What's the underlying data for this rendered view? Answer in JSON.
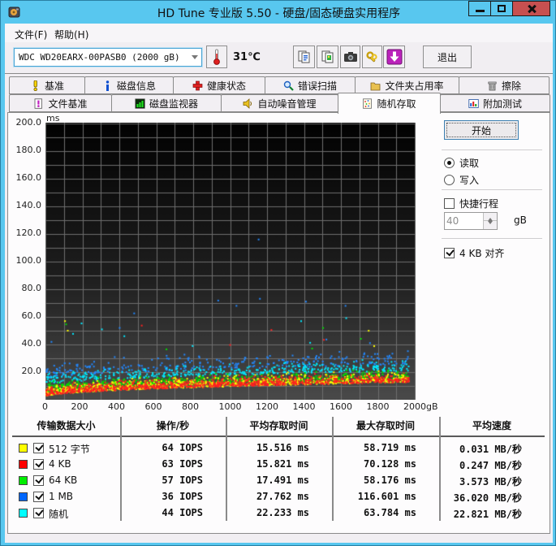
{
  "window": {
    "title": "HD Tune 专业版 5.50 - 硬盘/固态硬盘实用程序",
    "buttons": [
      "minimize",
      "maximize",
      "close"
    ]
  },
  "menu": {
    "file": "文件(F)",
    "help": "帮助(H)"
  },
  "toolbar": {
    "drive_selected": "WDC WD20EARX-00PASB0  (2000 gB)",
    "temperature": "31℃",
    "exit": "退出",
    "icon_buttons": [
      "thermometer-icon",
      "copy-text-icon",
      "copy-image-icon",
      "screenshot-icon",
      "options-icon",
      "save-icon"
    ]
  },
  "tabs": {
    "active": "随机存取",
    "row1": [
      {
        "label": "基准",
        "icon": "benchmark-icon",
        "w": 94
      },
      {
        "label": "磁盘信息",
        "icon": "disk-info-icon",
        "w": 110
      },
      {
        "label": "健康状态",
        "icon": "health-icon",
        "w": 114
      },
      {
        "label": "错误扫描",
        "icon": "error-scan-icon",
        "w": 112
      },
      {
        "label": "文件夹占用率",
        "icon": "folder-usage-icon",
        "w": 129
      },
      {
        "label": "擦除",
        "icon": "erase-icon",
        "w": 112
      }
    ],
    "row2": [
      {
        "label": "文件基准",
        "icon": "file-benchmark-icon",
        "w": 127
      },
      {
        "label": "磁盘监视器",
        "icon": "disk-monitor-icon",
        "w": 136
      },
      {
        "label": "自动噪音管理",
        "icon": "aam-icon",
        "w": 145
      },
      {
        "label": "随机存取",
        "icon": "random-access-icon",
        "w": 127
      },
      {
        "label": "附加测试",
        "icon": "extra-tests-icon",
        "w": 136
      }
    ]
  },
  "controls": {
    "start": "开始",
    "read": "读取",
    "write": "写入",
    "read_selected": true,
    "short_stroke": "快捷行程",
    "short_stroke_checked": false,
    "short_stroke_value": "40",
    "unit": "gB",
    "align": "4 KB 对齐",
    "align_checked": true
  },
  "chart_data": {
    "type": "scatter",
    "xlabel": "gB",
    "ylabel": "ms",
    "xlim": [
      0,
      2000
    ],
    "ylim": [
      0,
      200
    ],
    "x_ticks": [
      "0",
      "200",
      "400",
      "600",
      "800",
      "1000",
      "1200",
      "1400",
      "1600",
      "1800",
      "2000gB"
    ],
    "y_ticks": [
      "200.0",
      "180.0",
      "160.0",
      "140.0",
      "120.0",
      "100.0",
      "80.0",
      "60.0",
      "40.0",
      "20.0"
    ],
    "grid": {
      "x_step": 100,
      "y_step": 10,
      "color": "#6e6e6e"
    },
    "background": {
      "top": "#020202",
      "bottom": "#4a4a4a"
    },
    "envelope": {
      "min_ms": 2.5,
      "rise_ms": 10.5
    },
    "series": [
      {
        "name": "512 字节",
        "color": "#ffff00",
        "iops": 64,
        "avg_access_ms": 15.516,
        "max_access_ms": 58.719,
        "avg_speed_mb_s": 0.031,
        "points_n": 900,
        "band_base": 0.3,
        "band_spread": 7.0,
        "tails": {
          "n": 4,
          "lo": 35,
          "hi": 58
        }
      },
      {
        "name": "4 KB",
        "color": "#ff2020",
        "iops": 63,
        "avg_access_ms": 15.821,
        "max_access_ms": 70.128,
        "avg_speed_mb_s": 0.247,
        "points_n": 900,
        "band_base": 0.2,
        "band_spread": 6.5,
        "tails": {
          "n": 4,
          "lo": 35,
          "hi": 70
        }
      },
      {
        "name": "64 KB",
        "color": "#00dd00",
        "iops": 57,
        "avg_access_ms": 17.491,
        "max_access_ms": 58.176,
        "avg_speed_mb_s": 3.573,
        "points_n": 850,
        "band_base": 1.8,
        "band_spread": 7.0,
        "tails": {
          "n": 5,
          "lo": 35,
          "hi": 58
        }
      },
      {
        "name": "1 MB",
        "color": "#2288ff",
        "iops": 36,
        "avg_access_ms": 27.762,
        "max_access_ms": 116.601,
        "avg_speed_mb_s": 36.02,
        "points_n": 300,
        "band_base": 13.0,
        "band_spread": 10.0,
        "tails": {
          "n": 10,
          "lo": 40,
          "hi": 75
        },
        "outliers": [
          [
            1150,
            116.6
          ]
        ]
      },
      {
        "name": "随机",
        "color": "#00e8ff",
        "iops": 44,
        "avg_access_ms": 22.233,
        "max_access_ms": 63.784,
        "avg_speed_mb_s": 22.821,
        "points_n": 430,
        "band_base": 8.5,
        "band_spread": 7.5,
        "tails": {
          "n": 8,
          "lo": 36,
          "hi": 63
        }
      }
    ],
    "draw_order": [
      3,
      4,
      2,
      0,
      1
    ],
    "x_max_data": 1965,
    "seed": 1337
  },
  "table": {
    "headers": [
      "传输数据大小",
      "操作/秒",
      "平均存取时间",
      "最大存取时间",
      "平均速度"
    ],
    "col_edges": [
      14,
      147,
      277,
      408,
      540,
      670
    ],
    "rows": [
      {
        "swatch": "#ffff00",
        "checked": true,
        "label": "512 字节",
        "iops": "64 IOPS",
        "avg": "15.516 ms",
        "max": "58.719 ms",
        "speed": "0.031 MB/秒"
      },
      {
        "swatch": "#ff0000",
        "checked": true,
        "label": "4 KB",
        "iops": "63 IOPS",
        "avg": "15.821 ms",
        "max": "70.128 ms",
        "speed": "0.247 MB/秒"
      },
      {
        "swatch": "#00ee00",
        "checked": true,
        "label": "64 KB",
        "iops": "57 IOPS",
        "avg": "17.491 ms",
        "max": "58.176 ms",
        "speed": "3.573 MB/秒"
      },
      {
        "swatch": "#0066ff",
        "checked": true,
        "label": "1 MB",
        "iops": "36 IOPS",
        "avg": "27.762 ms",
        "max": "116.601 ms",
        "speed": "36.020 MB/秒"
      },
      {
        "swatch": "#00ffff",
        "checked": true,
        "label": "随机",
        "iops": "44 IOPS",
        "avg": "22.233 ms",
        "max": "63.784 ms",
        "speed": "22.821 MB/秒"
      }
    ]
  }
}
